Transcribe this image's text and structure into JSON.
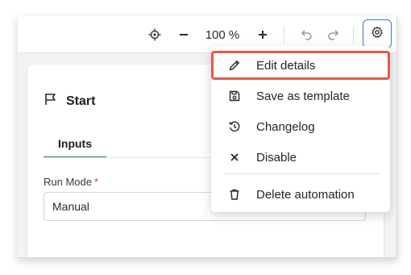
{
  "toolbar": {
    "zoom_level": "100 %",
    "icons": [
      "center-target-icon",
      "zoom-out-icon",
      "zoom-in-icon",
      "undo-icon",
      "redo-icon",
      "settings-gear-icon"
    ]
  },
  "panel": {
    "title": "Start",
    "tab_inputs": "Inputs",
    "run_mode_label": "Run Mode",
    "required_mark": "*",
    "run_mode_value": "Manual"
  },
  "menu": {
    "items": [
      {
        "label": "Edit details",
        "icon": "pencil-icon",
        "highlighted": true
      },
      {
        "label": "Save as template",
        "icon": "save-icon"
      },
      {
        "label": "Changelog",
        "icon": "history-icon"
      },
      {
        "label": "Disable",
        "icon": "close-icon"
      },
      {
        "label": "Delete automation",
        "icon": "trash-icon"
      }
    ]
  },
  "colors": {
    "accent_tab": "#1a8a4e",
    "highlight_outline": "#e4584b",
    "settings_border": "#4b6bd6",
    "required": "#d93025"
  }
}
